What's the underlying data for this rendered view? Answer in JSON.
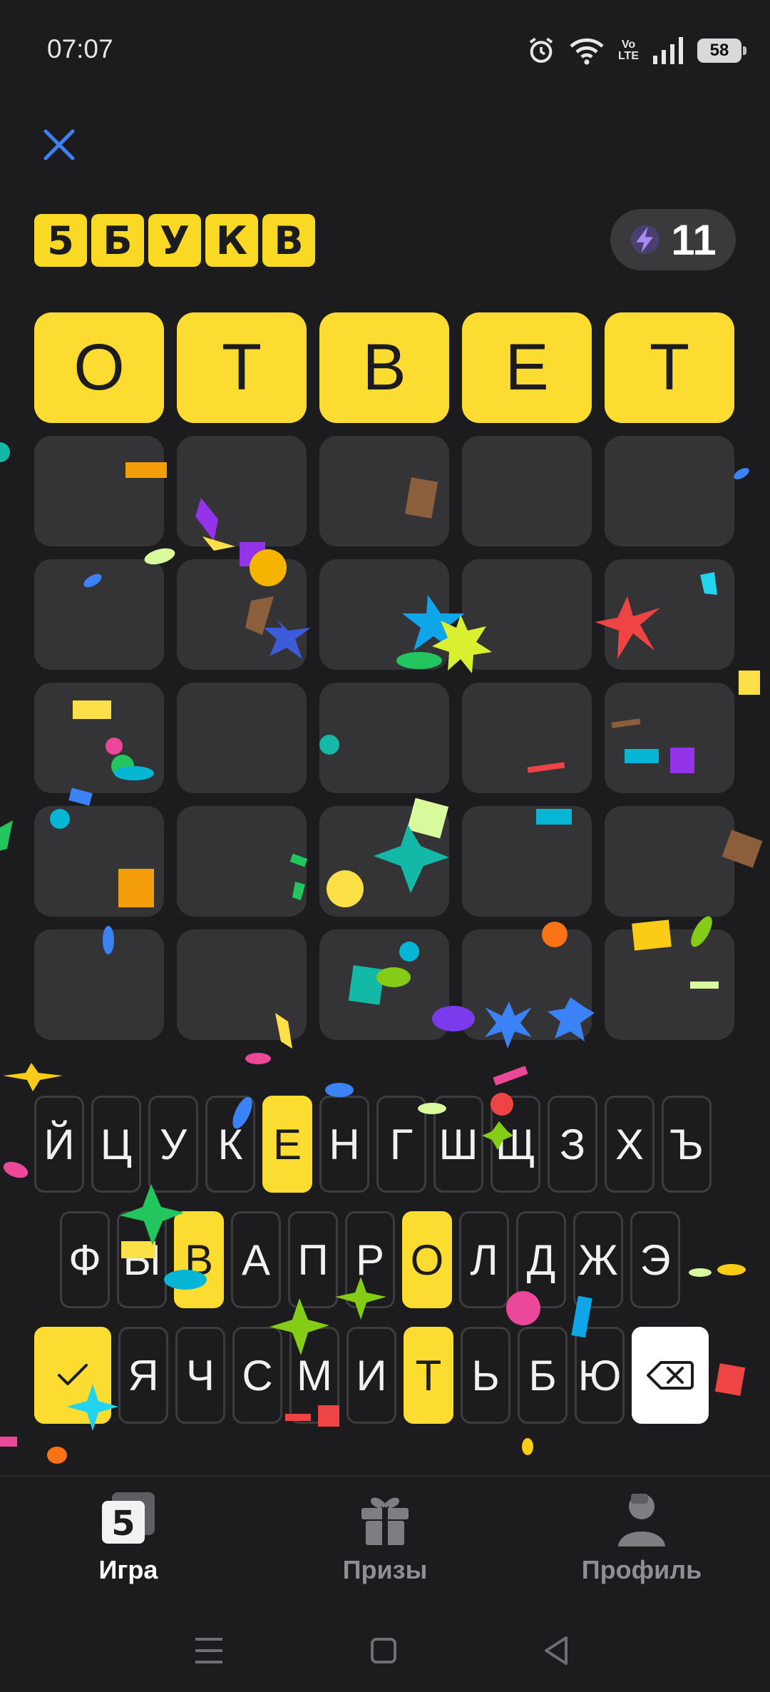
{
  "status": {
    "time": "07:07",
    "volte_top": "Vo",
    "volte_bottom": "LTE",
    "battery": "58"
  },
  "header": {
    "logo_letters": [
      "5",
      "Б",
      "У",
      "К",
      "В"
    ],
    "score": "11"
  },
  "board": {
    "rows": [
      [
        {
          "letter": "О",
          "state": "correct"
        },
        {
          "letter": "Т",
          "state": "correct"
        },
        {
          "letter": "В",
          "state": "correct"
        },
        {
          "letter": "Е",
          "state": "correct"
        },
        {
          "letter": "Т",
          "state": "correct"
        }
      ],
      [
        {
          "letter": "",
          "state": "empty"
        },
        {
          "letter": "",
          "state": "empty"
        },
        {
          "letter": "",
          "state": "empty"
        },
        {
          "letter": "",
          "state": "empty"
        },
        {
          "letter": "",
          "state": "empty"
        }
      ],
      [
        {
          "letter": "",
          "state": "empty"
        },
        {
          "letter": "",
          "state": "empty"
        },
        {
          "letter": "",
          "state": "empty"
        },
        {
          "letter": "",
          "state": "empty"
        },
        {
          "letter": "",
          "state": "empty"
        }
      ],
      [
        {
          "letter": "",
          "state": "empty"
        },
        {
          "letter": "",
          "state": "empty"
        },
        {
          "letter": "",
          "state": "empty"
        },
        {
          "letter": "",
          "state": "empty"
        },
        {
          "letter": "",
          "state": "empty"
        }
      ],
      [
        {
          "letter": "",
          "state": "empty"
        },
        {
          "letter": "",
          "state": "empty"
        },
        {
          "letter": "",
          "state": "empty"
        },
        {
          "letter": "",
          "state": "empty"
        },
        {
          "letter": "",
          "state": "empty"
        }
      ],
      [
        {
          "letter": "",
          "state": "empty"
        },
        {
          "letter": "",
          "state": "empty"
        },
        {
          "letter": "",
          "state": "empty"
        },
        {
          "letter": "",
          "state": "empty"
        },
        {
          "letter": "",
          "state": "empty"
        }
      ]
    ]
  },
  "keyboard": {
    "row1": [
      "Й",
      "Ц",
      "У",
      "К",
      "Е",
      "Н",
      "Г",
      "Ш",
      "Щ",
      "З",
      "Х",
      "Ъ"
    ],
    "row2": [
      "Ф",
      "Ы",
      "В",
      "А",
      "П",
      "Р",
      "О",
      "Л",
      "Д",
      "Ж",
      "Э"
    ],
    "row3": [
      "Я",
      "Ч",
      "С",
      "М",
      "И",
      "Т",
      "Ь",
      "Б",
      "Ю"
    ],
    "highlighted": [
      "Е",
      "В",
      "О",
      "Т"
    ],
    "enter_icon": "check-icon",
    "delete_icon": "backspace-icon"
  },
  "bottom_nav": {
    "items": [
      {
        "label": "Игра",
        "icon": "game-logo-icon",
        "active": true
      },
      {
        "label": "Призы",
        "icon": "gift-icon",
        "active": false
      },
      {
        "label": "Профиль",
        "icon": "profile-icon",
        "active": false
      }
    ]
  },
  "colors": {
    "background": "#1c1c1e",
    "tile": "#343436",
    "accent": "#fddc31"
  }
}
